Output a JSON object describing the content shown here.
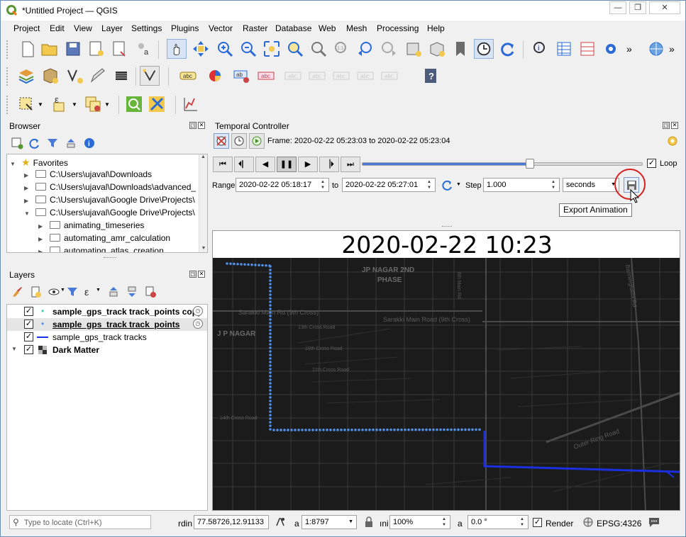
{
  "window": {
    "title": "*Untitled Project — QGIS",
    "controls": [
      "—",
      "❐",
      "✕"
    ]
  },
  "menu": [
    "Project",
    "Edit",
    "View",
    "Layer",
    "Settings",
    "Plugins",
    "Vector",
    "Raster",
    "Database",
    "Web",
    "Mesh",
    "Processing",
    "Help"
  ],
  "browser": {
    "title": "Browser",
    "items": [
      {
        "label": "Favorites",
        "level": 0,
        "expanded": true,
        "star": true
      },
      {
        "label": "C:\\Users\\ujaval\\Downloads",
        "level": 1,
        "expanded": false
      },
      {
        "label": "C:\\Users\\ujaval\\Downloads\\advanced_",
        "level": 1,
        "expanded": false
      },
      {
        "label": "C:\\Users\\ujaval\\Google Drive\\Projects\\",
        "level": 1,
        "expanded": false
      },
      {
        "label": "C:\\Users\\ujaval\\Google Drive\\Projects\\",
        "level": 1,
        "expanded": true
      },
      {
        "label": "animating_timeseries",
        "level": 2,
        "expanded": false
      },
      {
        "label": "automating_amr_calculation",
        "level": 2,
        "expanded": false
      },
      {
        "label": "automating_atlas_creation",
        "level": 2,
        "expanded": false
      }
    ]
  },
  "layers": {
    "title": "Layers",
    "items": [
      {
        "label": "sample_gps_track track_points copy",
        "checked": true,
        "bold": true,
        "underline": false,
        "temporal": true
      },
      {
        "label": "sample_gps_track track_points",
        "checked": true,
        "bold": true,
        "underline": true,
        "temporal": true
      },
      {
        "label": "sample_gps_track tracks",
        "checked": true,
        "bold": false,
        "underline": false,
        "temporal": false
      },
      {
        "label": "Dark Matter",
        "checked": true,
        "bold": true,
        "underline": false,
        "temporal": false
      }
    ]
  },
  "temporal": {
    "title": "Temporal Controller",
    "frame_text": "Frame: 2020-02-22 05:23:03 to 2020-02-22 05:23:04",
    "loop_label": "Loop",
    "loop_checked": true,
    "range_label": "Range",
    "range_from": "2020-02-22 05:18:17",
    "to_label": "to",
    "range_to": "2020-02-22 05:27:01",
    "step_label": "Step",
    "step_value": "1.000",
    "unit_value": "seconds",
    "slider_position": 0.6,
    "tooltip": "Export Animation"
  },
  "map": {
    "timestamp": "2020-02-22 10:23",
    "labels": [
      "JP NAGAR 2ND",
      "PHASE",
      "Sarakki Main Rd (9th Cross)",
      "Sarakki Main Road (9th Cross)",
      "J P NAGAR",
      "Outer Ring Road",
      "Bannerghatta Rd",
      "13th Cross Road",
      "10th Cross Road",
      "11th Cross Road",
      "6th Main Rd",
      "14th Cross Road"
    ]
  },
  "status": {
    "locate_placeholder": "Type to locate (Ctrl+K)",
    "coord_label": "rdin",
    "coordinate": "77.58726,12.91133",
    "scale_label": "a",
    "scale": "1:8797",
    "magnifier_label": "ıni",
    "magnifier": "100%",
    "rotation_label": "a",
    "rotation": "0.0 °",
    "render_label": "Render",
    "render_checked": true,
    "crs": "EPSG:4326"
  },
  "colors": {
    "accent": "#4a7ad9",
    "track_points": "#4f8fe6",
    "track_line": "#1a2fe0",
    "highlight_circle": "#d92020",
    "map_bg": "#1b1b1b"
  }
}
